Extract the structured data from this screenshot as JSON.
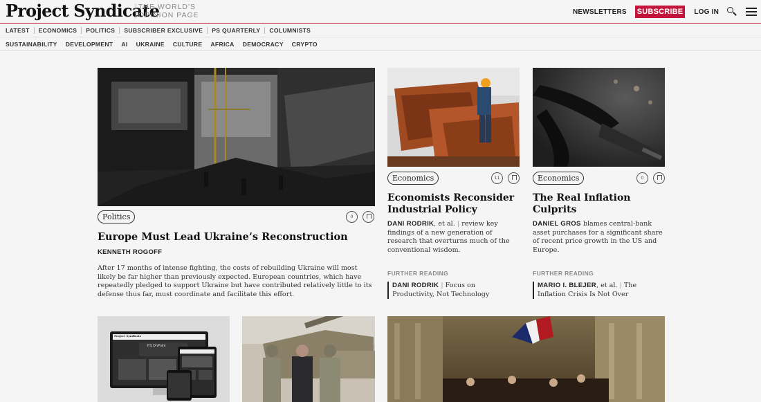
{
  "header": {
    "logo": "Project Syndicate",
    "tagline": "THE WORLD'S OPINION PAGE",
    "newsletters": "NEWSLETTERS",
    "subscribe": "SUBSCRIBE",
    "login": "LOG IN"
  },
  "nav_primary": [
    "LATEST",
    "ECONOMICS",
    "POLITICS",
    "SUBSCRIBER EXCLUSIVE",
    "PS QUARTERLY",
    "COLUMNISTS"
  ],
  "nav_secondary": [
    "SUSTAINABILITY",
    "DEVELOPMENT",
    "AI",
    "UKRAINE",
    "CULTURE",
    "AFRICA",
    "DEMOCRACY",
    "CRYPTO"
  ],
  "feature": {
    "tag": "Politics",
    "headline": "Europe Must Lead Ukraine’s Reconstruction",
    "author": "KENNETH ROGOFF",
    "blurb": "After 17 months of intense fighting, the costs of rebuilding Ukraine will most likely be far higher than previously expected. European countries, which have repeatedly pledged to support Ukraine but have contributed relatively little to its defense thus far, must coordinate and facilitate this effort.",
    "comments": "0"
  },
  "card2": {
    "tag": "Economics",
    "headline": "Economists Reconsider Industrial Policy",
    "author": "DANI RODRIK",
    "author_suffix": ", et al.",
    "blurb": "review key findings of a new generation of research that overturns much of the conventional wisdom.",
    "comments": "11",
    "further_label": "FURTHER READING",
    "further_author": "DANI RODRIK",
    "further_title": "Focus on Productivity, Not Technology"
  },
  "card3": {
    "tag": "Economics",
    "headline": "The Real Inflation Culprits",
    "author": "DANIEL GROS",
    "blurb": "blames central-bank asset purchases for a significant share of recent price growth in the US and Europe.",
    "comments": "0",
    "further_label": "FURTHER READING",
    "further_author": "MARIO I. BLEJER",
    "further_suffix": ", et al.",
    "further_title": "The Inflation Crisis Is Not Over"
  },
  "promo": {
    "screen_logo": "Project Syndicate",
    "screen_title": "PS OnPoint"
  }
}
